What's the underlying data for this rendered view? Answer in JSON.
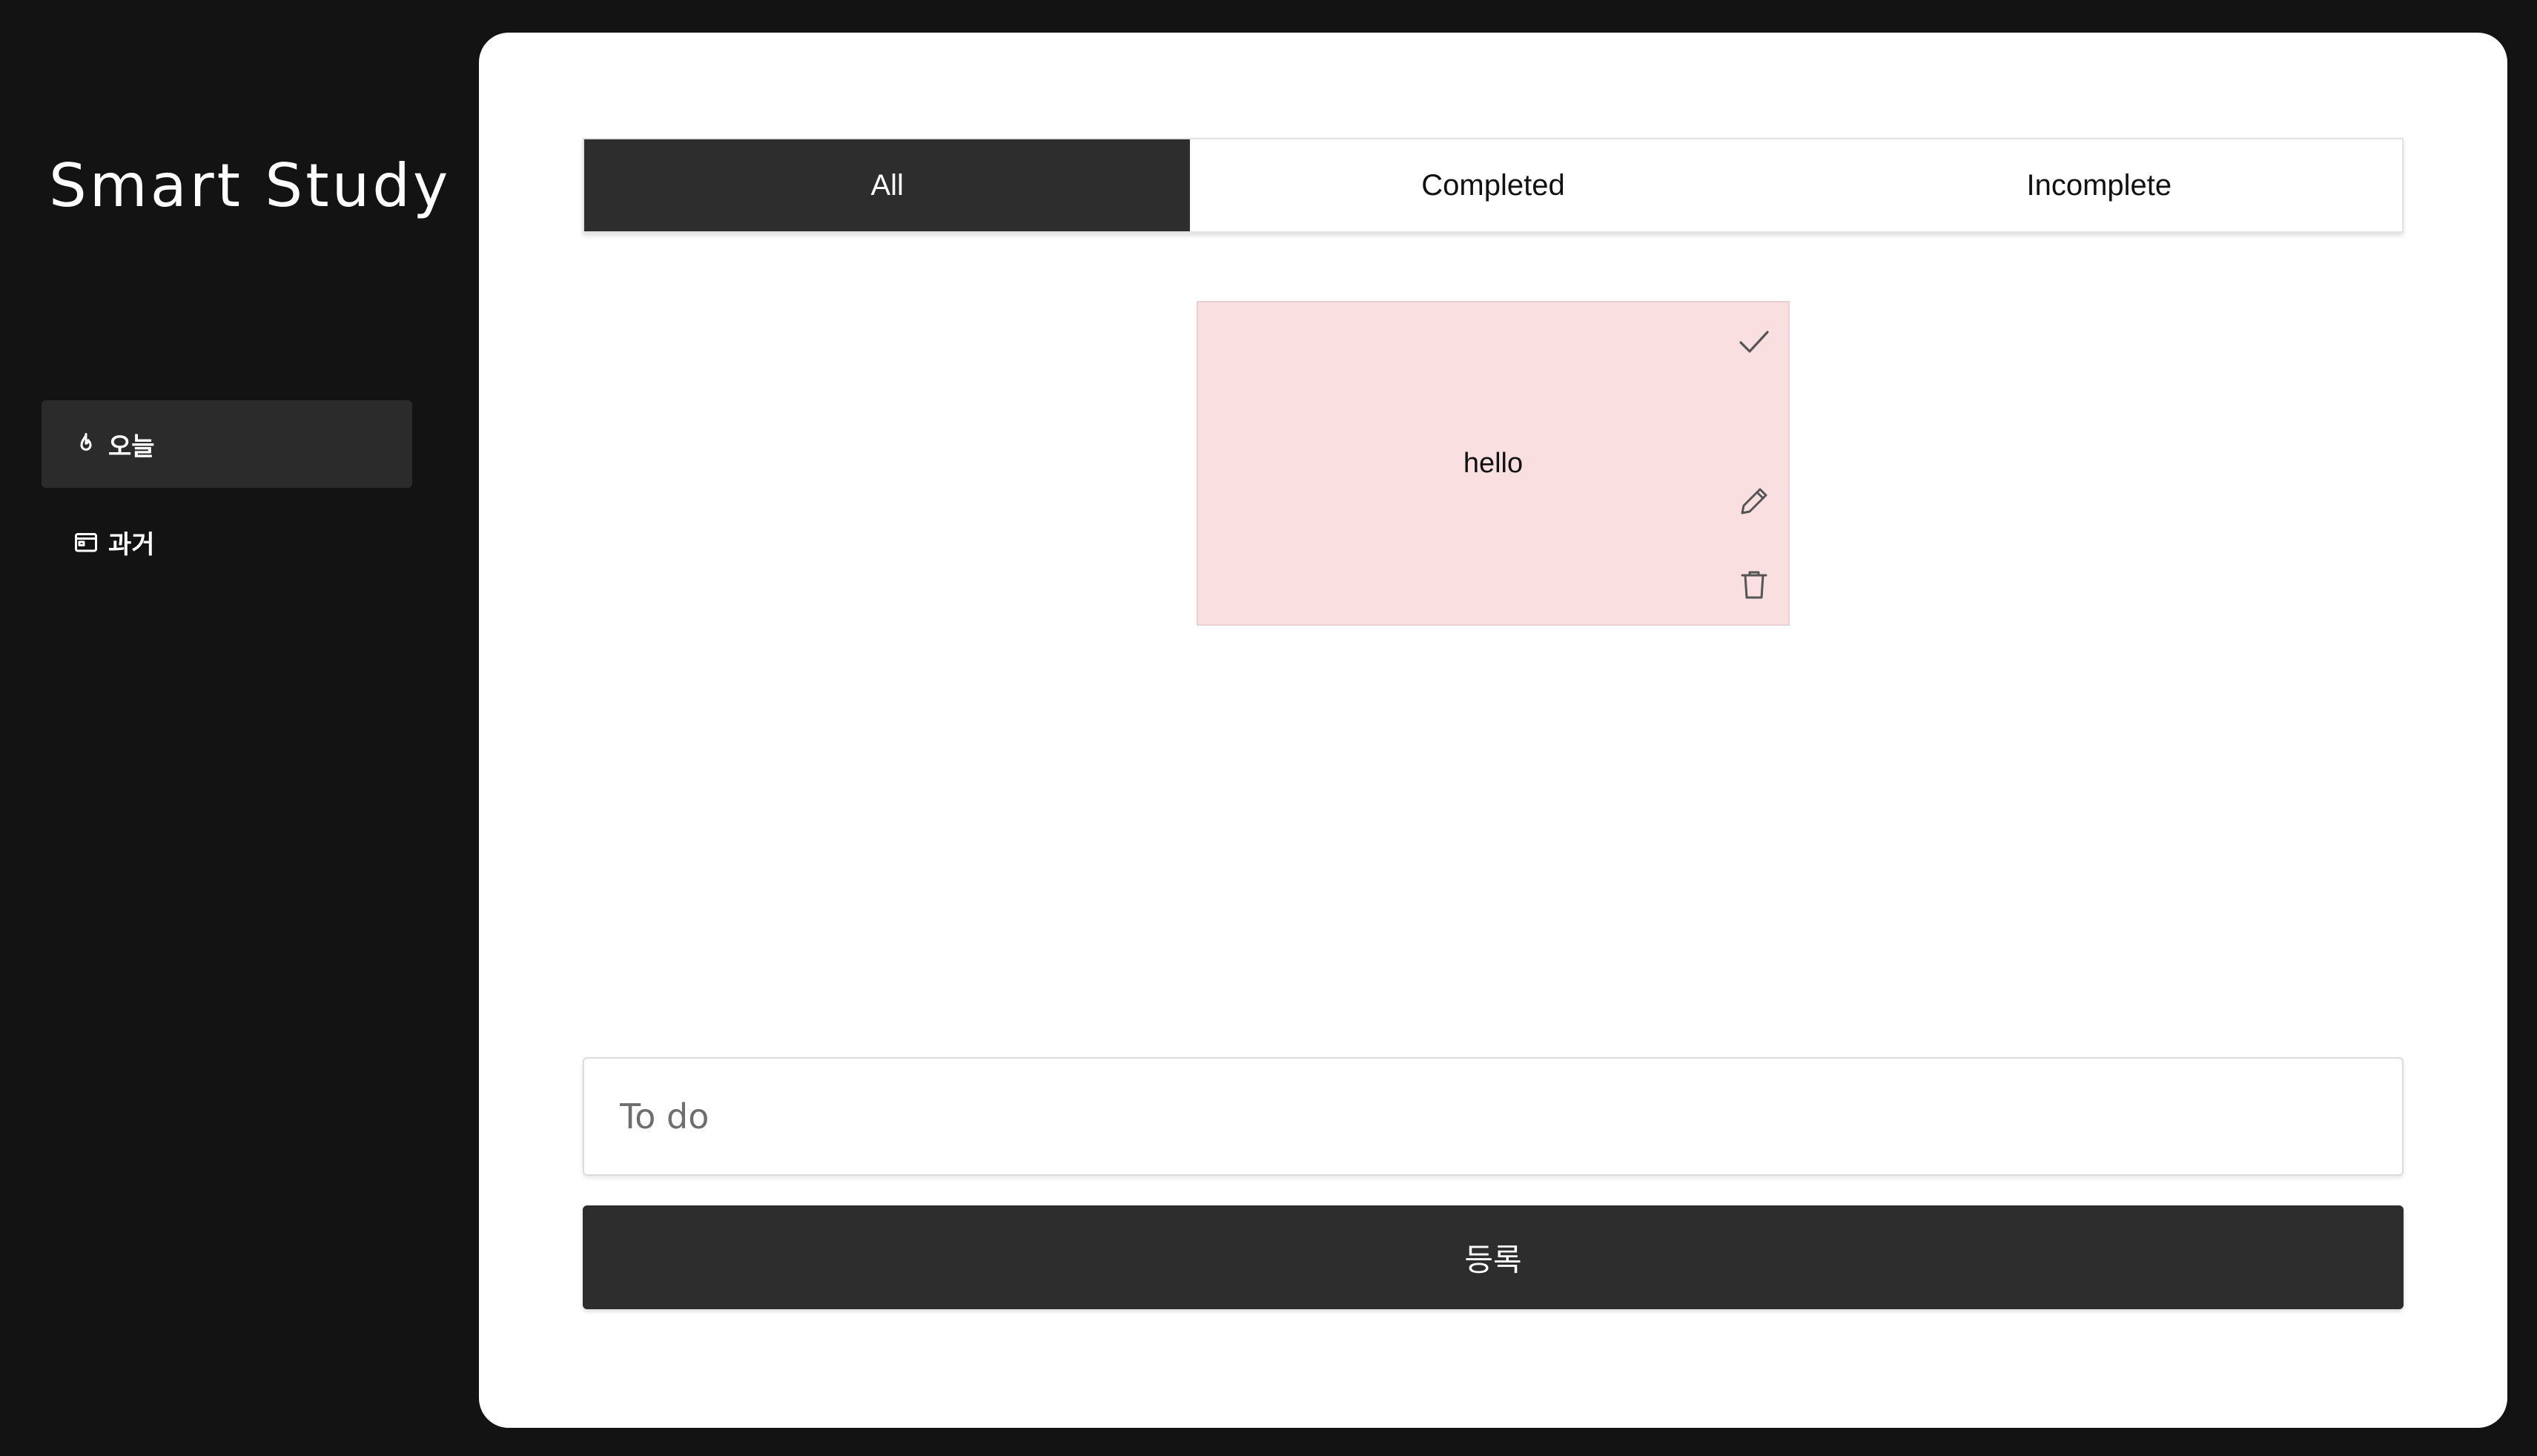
{
  "sidebar": {
    "title": "Smart Study",
    "items": [
      {
        "label": "오늘",
        "icon": "flame-icon",
        "active": true
      },
      {
        "label": "과거",
        "icon": "calendar-icon",
        "active": false
      }
    ]
  },
  "tabs": [
    {
      "label": "All",
      "active": true
    },
    {
      "label": "Completed",
      "active": false
    },
    {
      "label": "Incomplete",
      "active": false
    }
  ],
  "todos": [
    {
      "text": "hello",
      "color": "#fadfe0",
      "actions": [
        "check-icon",
        "pencil-icon",
        "trash-icon"
      ]
    }
  ],
  "input": {
    "placeholder": "To do",
    "value": ""
  },
  "submit": {
    "label": "등록"
  },
  "colors": {
    "background": "#131313",
    "active_tab": "#2d2d2d",
    "card": "#fadfe0",
    "button": "#2d2d2d"
  }
}
